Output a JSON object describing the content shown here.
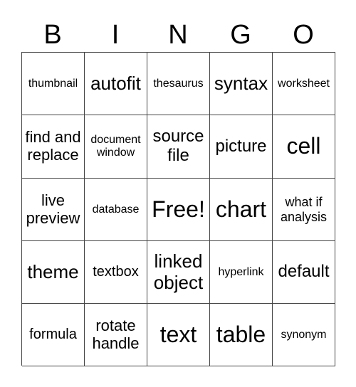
{
  "header": [
    "B",
    "I",
    "N",
    "G",
    "O"
  ],
  "cells": [
    [
      "thumbnail",
      "autofit",
      "thesaurus",
      "syntax",
      "worksheet"
    ],
    [
      "find and replace",
      "document window",
      "source file",
      "picture",
      "cell"
    ],
    [
      "live preview",
      "database",
      "Free!",
      "chart",
      "what if analysis"
    ],
    [
      "theme",
      "textbox",
      "linked object",
      "hyperlink",
      "default"
    ],
    [
      "formula",
      "rotate handle",
      "text",
      "table",
      "synonym"
    ]
  ]
}
